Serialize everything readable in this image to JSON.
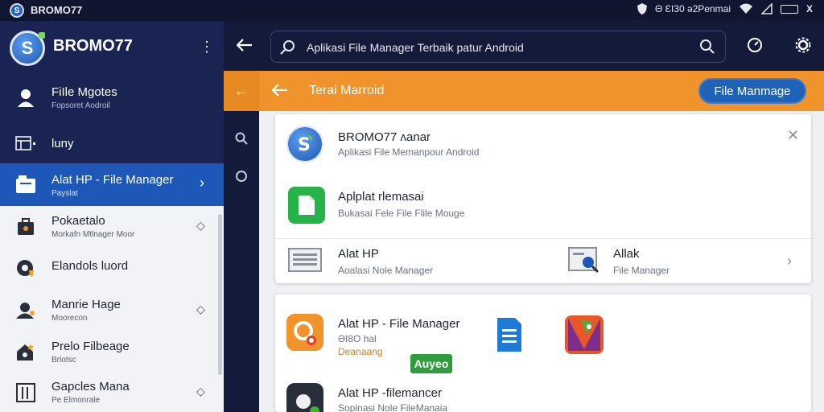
{
  "status_bar": {
    "app_title": "BROMO77",
    "status_text": "Θ ƐI30 ə2Penmai",
    "close": "X"
  },
  "sidebar": {
    "brand": "BROMO77",
    "logo_letter": "S",
    "menu_glyph": "⋮",
    "items": [
      {
        "label": "FiIle Mgotes",
        "sub": "Fopsoret Aodroil"
      },
      {
        "label": "luny",
        "sub": ""
      },
      {
        "label": "Alat HP - File Manager",
        "sub": "Payslat"
      },
      {
        "label": "Pokaetalo",
        "sub": "Morkafn Mtlnager Moor"
      },
      {
        "label": "Elandols luord",
        "sub": ""
      },
      {
        "label": "Manrie Hage",
        "sub": "Moorecon"
      },
      {
        "label": "Prelo Filbeage",
        "sub": "Brlotsc"
      },
      {
        "label": "Gapcles Mana",
        "sub": "Pe Elmonrale"
      }
    ]
  },
  "topbar": {
    "search_text": "Aplikasi File Manager Terbaik patur Android"
  },
  "orange_bar": {
    "title": "Terai Marroid",
    "button_label": "File Manmage"
  },
  "card1": {
    "rows": [
      {
        "title": "BROMO77 ʌanar",
        "sub": "Aplikasi File Memanpour Android"
      },
      {
        "title": "Aplplat rlemasai",
        "sub": "Bukasai Fele File Flile Mouge"
      }
    ],
    "pair": [
      {
        "title": "Alat HP",
        "sub": "Aoalasi Nole Manager"
      },
      {
        "title": "Allak",
        "sub": "File Manager"
      }
    ]
  },
  "card2": {
    "rows": [
      {
        "title": "Alat HP - File Manager",
        "sub": "ƏI8O hal",
        "sub2": "Deanaang",
        "badge": "Auyeo"
      },
      {
        "title": "Alat HP -filemancer",
        "sub": "Sopinasi Nole FileManaia"
      }
    ]
  },
  "colors": {
    "accent_orange": "#f0932a",
    "accent_blue": "#1d58b8",
    "dark_bg": "#141b3a",
    "badge_green": "#2f9d3e"
  },
  "icons": [
    "wifi-icon",
    "signal-icon",
    "battery-icon",
    "search-icon",
    "back-arrow-icon",
    "settings-icon",
    "more-icon"
  ]
}
